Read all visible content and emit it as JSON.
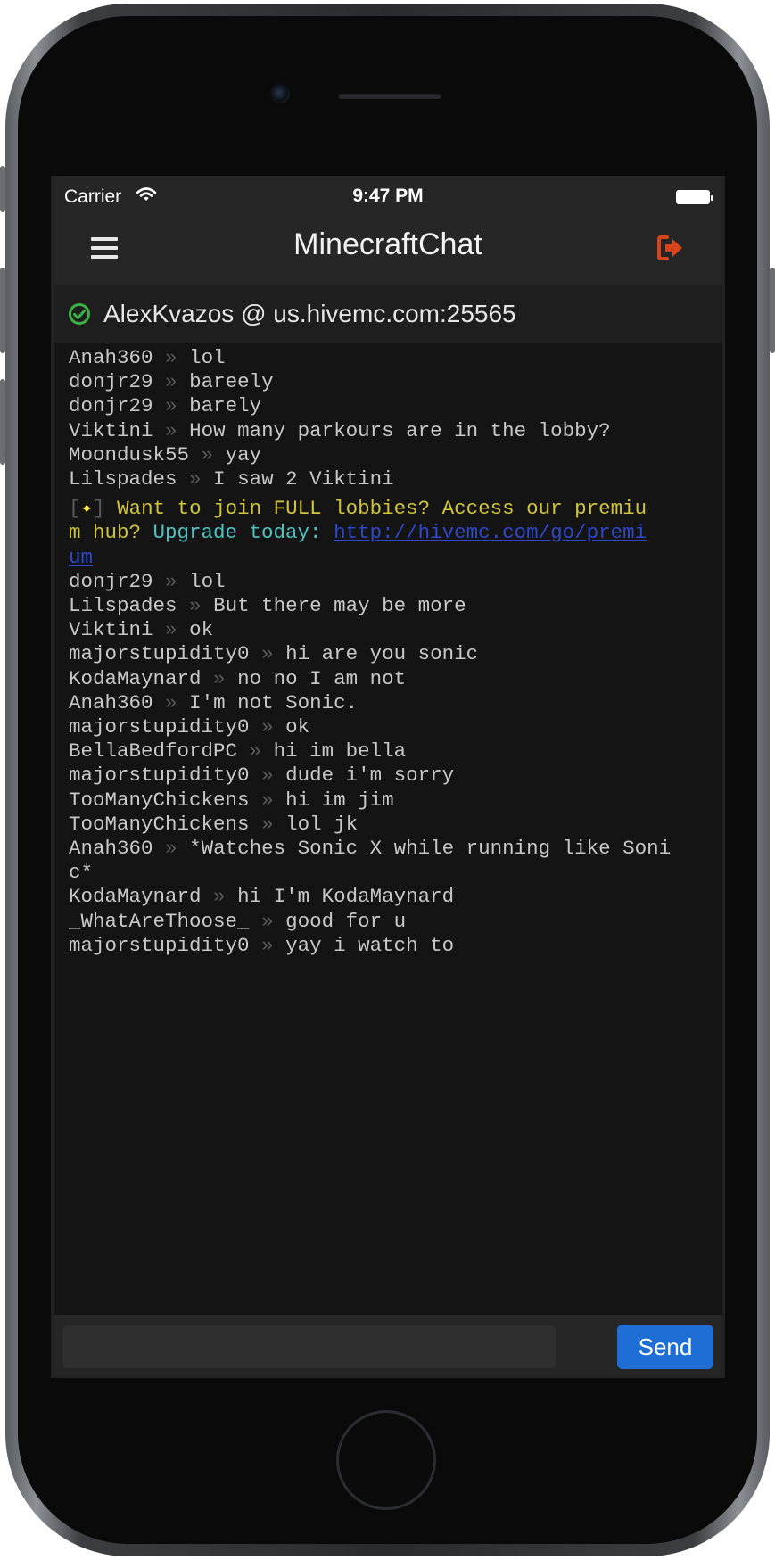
{
  "status_bar": {
    "carrier": "Carrier",
    "time": "9:47 PM"
  },
  "navbar": {
    "title": "MinecraftChat",
    "menu_icon": "hamburger-menu-icon",
    "logout_icon": "logout-icon"
  },
  "server": {
    "connection_status": "connected",
    "label": "AlexKvazos @ us.hivemc.com:25565"
  },
  "colors": {
    "background": "#141414",
    "bar_background": "#262626",
    "send_button": "#1f6ed6",
    "logout_icon": "#d6441c",
    "connected_icon": "#3cb043",
    "promo_yellow": "#cfc43c",
    "promo_cyan": "#4fc2c2",
    "promo_link": "#2f47c9"
  },
  "chat": {
    "separator": "»",
    "before": [
      {
        "user": "Anah360",
        "text": "lol"
      },
      {
        "user": "donjr29",
        "text": "bareely"
      },
      {
        "user": "donjr29",
        "text": "barely"
      },
      {
        "user": "Viktini",
        "text": "How many parkours are in the lobby?"
      },
      {
        "user": "Moondusk55",
        "text": "yay"
      },
      {
        "user": "Lilspades",
        "text": "I saw 2 Viktini"
      }
    ],
    "promo": {
      "bracket_open": "[",
      "star": "✦",
      "bracket_close": "]",
      "yellow_text": " Want to join FULL lobbies? Access our premium hub? ",
      "cyan_text": "Upgrade today: ",
      "link": "http://hivemc.com/go/premium"
    },
    "after": [
      {
        "user": "donjr29",
        "text": "lol"
      },
      {
        "user": "Lilspades",
        "text": "But there may be more"
      },
      {
        "user": "Viktini",
        "text": "ok"
      },
      {
        "user": "majorstupidity0",
        "text": "hi are you sonic"
      },
      {
        "user": "KodaMaynard",
        "text": "no no I am not"
      },
      {
        "user": "Anah360",
        "text": "I'm not Sonic."
      },
      {
        "user": "majorstupidity0",
        "text": "ok"
      },
      {
        "user": "BellaBedfordPC",
        "text": "hi im bella"
      },
      {
        "user": "majorstupidity0",
        "text": "dude i'm sorry"
      },
      {
        "user": "TooManyChickens",
        "text": "hi im jim"
      },
      {
        "user": "TooManyChickens",
        "text": "lol jk"
      },
      {
        "user": "Anah360",
        "text": "*Watches Sonic X while running like Soni\nc*"
      },
      {
        "user": "KodaMaynard",
        "text": "hi I'm KodaMaynard"
      },
      {
        "user": "_WhatAreThoose_",
        "text": "good for u"
      },
      {
        "user": "majorstupidity0",
        "text": "yay i watch to"
      }
    ]
  },
  "input": {
    "placeholder": "",
    "value": ""
  },
  "send_button": {
    "label": "Send"
  }
}
